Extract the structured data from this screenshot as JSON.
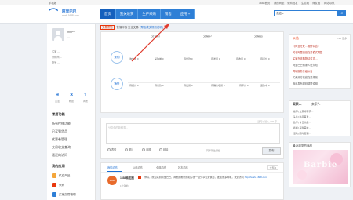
{
  "topstrip": {
    "left": "手机版",
    "items": [
      "1688首页",
      "我的阿里",
      "采购批发",
      "生意经",
      "商友圈",
      "网站导航"
    ]
  },
  "header": {
    "logo_title": "阿里巴巴",
    "logo_sub": "work.1688.com",
    "nav": [
      {
        "label": "首页",
        "active": true
      },
      {
        "label": "我关进货",
        "active": false
      },
      {
        "label": "生产采购",
        "active": false
      },
      {
        "label": "销售",
        "active": false
      },
      {
        "label": "应用 +",
        "active": false
      }
    ],
    "search_select": "供应 ▾",
    "search_placeholder": "",
    "search_icon": "search-icon"
  },
  "sidebar": {
    "user_name": "mm***",
    "user_sub": "...",
    "rows": [
      "买家 ...",
      "采购商 ...",
      "账号 ..."
    ],
    "stats": [
      {
        "num": "9",
        "label": "关注"
      },
      {
        "num": "3",
        "label": "粉丝"
      },
      {
        "num": "1",
        "label": "商友"
      }
    ],
    "section_title": "常用功能",
    "links": [
      "所有传统功能",
      "已买到货品",
      "优惠卷管理",
      "交易收支查询",
      "最近的访问"
    ],
    "my_section": "我的应用",
    "apps": [
      {
        "label": "供应产品",
        "color": "#f4a63a"
      },
      {
        "label": "采购",
        "color": "#e8380d"
      },
      {
        "label": "买家交易管理",
        "color": "#2e7fd6"
      }
    ]
  },
  "notice": {
    "tag": "交易须知",
    "text": "警惕诈骗 安全交易",
    "link": "[帮店成交规则说明]"
  },
  "flow": {
    "headers": [
      "交易前",
      "交易中",
      "交易后"
    ],
    "circle1": "采购",
    "circle2": "销售",
    "row1": [
      "询价中 0",
      "采购单 0",
      "待付款 0",
      "待发货 0",
      "待收货 0",
      "待评价 0"
    ],
    "row2": [
      "待报价 0",
      "待付款 0",
      "待发货 0",
      "待确认收货 0",
      "待评价 0",
      "退款中 0"
    ]
  },
  "post": {
    "placeholder": "分享你的新鲜事...",
    "count": "还可以输入 140 字",
    "opts": [
      "表情",
      "图片",
      "话题",
      "链接"
    ],
    "check": "同步到生意经",
    "button": "发布"
  },
  "feed": {
    "tabs": [
      "我的动态",
      "公司动态",
      "全部动态",
      "好友动态"
    ],
    "drop": "全部 ▾",
    "avatar": "1688",
    "user": "1688商友圈",
    "text": "你好，欢迎来到阿里巴巴，商友圈帮助您和好友一起分享生意信息，发现更多商机，欢迎访问",
    "link": "http://work.1688.com",
    "meta": "1分钟前"
  },
  "right": {
    "ann_title": "公告",
    "ann_meta": "1-25 更多",
    "announcements": [
      {
        "text": "《阿里旺旺…维修公告》",
        "dark": false
      },
      {
        "text": "关于阿里巴巴交易模式调整…",
        "dark": false
      },
      {
        "text": "买家在线购物请注意…",
        "dark": false
      },
      {
        "text": "阿里巴巴商家入驻须知",
        "dark": true
      },
      {
        "text": "同城服务升级公告",
        "dark": false
      },
      {
        "text": "买卖双方在线交易规则",
        "dark": true
      },
      {
        "text": "商品发布规则调整说明",
        "dark": true
      }
    ],
    "tabs": [
      "买家人",
      "卖家人"
    ],
    "list": [
      "[推荐] 生意好帮手…",
      "[头条] 新品首发…",
      "[数字] 今日热卖…",
      "[商机] 采购需求…",
      "[活动] 限时促销…"
    ],
    "browse_title": "最近浏览的商品",
    "img_text": "Barbie"
  }
}
